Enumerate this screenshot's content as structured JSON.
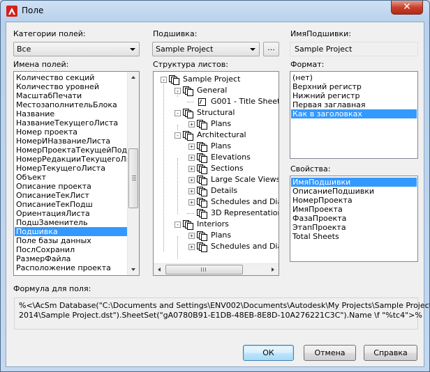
{
  "window": {
    "title": "Поле",
    "close_label": "✕"
  },
  "categories": {
    "label": "Категории полей:",
    "value": "Все"
  },
  "field_names": {
    "label": "Имена полей:",
    "items": [
      "Количество секций",
      "Количество уровней",
      "МасштабПечати",
      "МестозаполнительБлока",
      "Название",
      "НазваниеТекущегоЛиста",
      "Номер проекта",
      "НомерИНазваниеЛиста",
      "НомерПроектаТекущейПодшивки",
      "НомерРедакцииТекущегоЛиста",
      "НомерТекущегоЛиста",
      "Объект",
      "Описание проекта",
      "ОписаниеТекЛист",
      "ОписаниеТекПодш",
      "ОриентацияЛиста",
      "ПодшЗаменитель",
      "Подшивка",
      "Поле базы данных",
      "ПослСохранил",
      "РазмерФайла",
      "Расположение проекта"
    ],
    "selected": "Подшивка"
  },
  "sheetset": {
    "label": "Подшивка:",
    "value": "Sample Project",
    "browse_label": "..."
  },
  "sheetset_name": {
    "label": "ИмяПодшивки:",
    "value": "Sample Project"
  },
  "tree": {
    "label": "Структура листов:",
    "nodes": [
      "Sample Project",
      "General",
      "G001 - Title Sheet",
      "Structural",
      "Plans",
      "Architectural",
      "Plans",
      "Elevations",
      "Sections",
      "Large Scale Views",
      "Details",
      "Schedules and Diagr",
      "3D Representations",
      "Interiors",
      "Plans",
      "Schedules and Diagr"
    ]
  },
  "format": {
    "label": "Формат:",
    "items": [
      "(нет)",
      "Верхний регистр",
      "Нижний регистр",
      "Первая заглавная",
      "Как в заголовках"
    ],
    "selected": "Как в заголовках"
  },
  "properties": {
    "label": "Свойства:",
    "items": [
      "ИмяПодшивки",
      "ОписаниеПодшивки",
      "НомерПроекта",
      "ИмяПроекта",
      "ФазаПроекта",
      "ЭтапПроекта",
      "Total Sheets"
    ],
    "selected": "ИмяПодшивки"
  },
  "formula": {
    "label": "Формула для поля:",
    "line1": "%<\\AcSm Database(\"C:\\Documents and Settings\\ENV002\\Documents\\Autodesk\\My Projects\\Sample Project",
    "line2": "2014\\Sample Project.dst\").SheetSet(\"gA0780B91-E1DB-48EB-8E8D-10A276221C3C\").Name \\f \"%tc4\">%"
  },
  "buttons": {
    "ok": "ОК",
    "cancel": "Отмена",
    "help": "Справка"
  },
  "icons": [
    "autocad-logo-icon",
    "dropdown-arrow-icon",
    "sheetset-icon",
    "subset-icon",
    "sheet-icon",
    "expand-icon",
    "collapse-icon",
    "scroll-up-icon",
    "scroll-down-icon",
    "scroll-left-icon",
    "scroll-right-icon"
  ],
  "colors": {
    "selection": "#3399ff",
    "close_button": "#c8412c",
    "title_bar": "#c4d8ef",
    "logo": "#d3221d"
  }
}
